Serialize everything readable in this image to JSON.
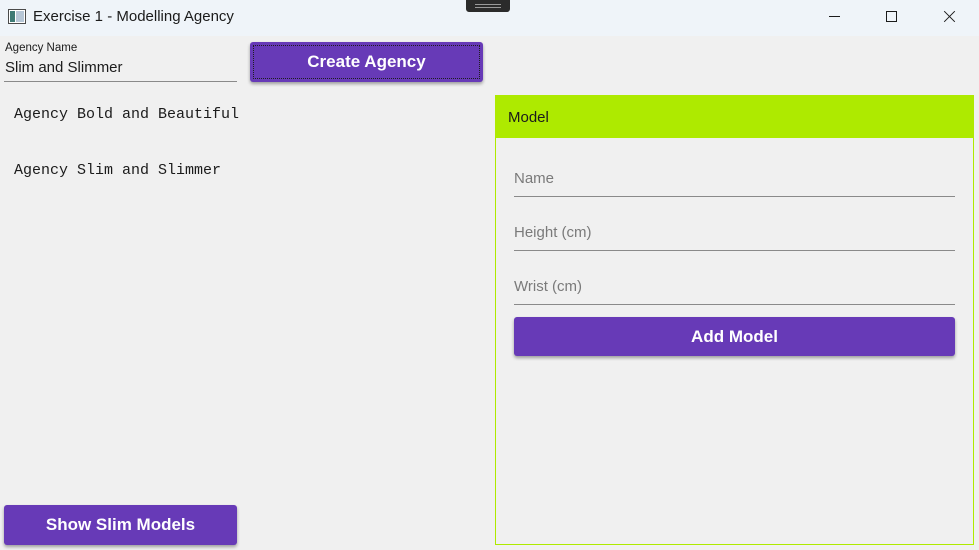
{
  "window": {
    "title": "Exercise 1 - Modelling Agency"
  },
  "agency_form": {
    "label": "Agency Name",
    "value": "Slim and Slimmer",
    "create_button": "Create Agency"
  },
  "agencies": [
    {
      "text": "Agency Bold and Beautiful"
    },
    {
      "text": "Agency Slim and Slimmer"
    }
  ],
  "model_panel": {
    "header": "Model",
    "name_placeholder": "Name",
    "height_placeholder": "Height (cm)",
    "wrist_placeholder": "Wrist (cm)",
    "add_button": "Add Model"
  },
  "show_slim_button": "Show Slim Models",
  "colors": {
    "accent_purple": "#673ab7",
    "panel_green": "#aeea00",
    "background": "#f0f0f0",
    "titlebar": "#eff4f9"
  },
  "icons": {
    "app": "app-window-icon",
    "minimize": "minimize-icon",
    "maximize": "maximize-icon",
    "close": "close-icon"
  }
}
